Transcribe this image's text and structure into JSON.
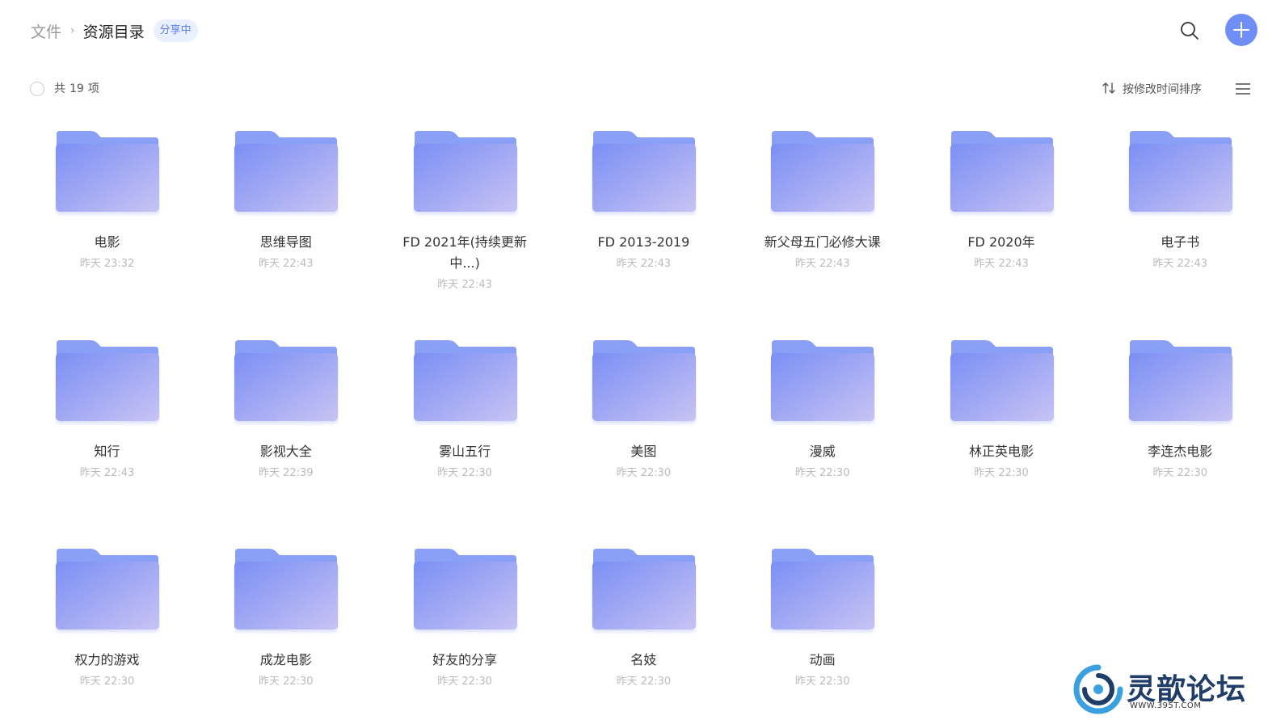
{
  "breadcrumb": {
    "root": "文件",
    "separator": "›",
    "current": "资源目录",
    "badge": "分享中"
  },
  "header": {
    "search_icon": "search-icon",
    "add_icon": "plus-icon",
    "accent_color": "#6f8ef7"
  },
  "toolbar": {
    "count_prefix": "共",
    "count": "19",
    "count_suffix": "项",
    "sort_label": "按修改时间排序",
    "sort_icon": "sort-arrows-icon",
    "view_icon": "list-view-icon"
  },
  "folders": [
    {
      "name": "电影",
      "time": "昨天 23:32"
    },
    {
      "name": "思维导图",
      "time": "昨天 22:43"
    },
    {
      "name": "FD 2021年(持续更新中...)",
      "time": "昨天 22:43"
    },
    {
      "name": "FD 2013-2019",
      "time": "昨天 22:43"
    },
    {
      "name": "新父母五门必修大课",
      "time": "昨天 22:43"
    },
    {
      "name": "FD 2020年",
      "time": "昨天 22:43"
    },
    {
      "name": "电子书",
      "time": "昨天 22:43"
    },
    {
      "name": "知行",
      "time": "昨天 22:43"
    },
    {
      "name": "影视大全",
      "time": "昨天 22:39"
    },
    {
      "name": "雾山五行",
      "time": "昨天 22:30"
    },
    {
      "name": "美图",
      "time": "昨天 22:30"
    },
    {
      "name": "漫威",
      "time": "昨天 22:30"
    },
    {
      "name": "林正英电影",
      "time": "昨天 22:30"
    },
    {
      "name": "李连杰电影",
      "time": "昨天 22:30"
    },
    {
      "name": "权力的游戏",
      "time": "昨天 22:30"
    },
    {
      "name": "成龙电影",
      "time": "昨天 22:30"
    },
    {
      "name": "好友的分享",
      "time": "昨天 22:30"
    },
    {
      "name": "名妓",
      "time": "昨天 22:30"
    },
    {
      "name": "动画",
      "time": "昨天 22:30"
    }
  ],
  "watermark": {
    "title": "灵歆论坛",
    "url": "WWW.395T.COM"
  }
}
